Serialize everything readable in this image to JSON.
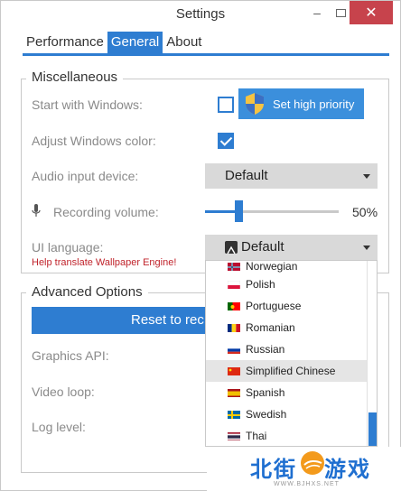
{
  "window": {
    "title": "Settings",
    "minimize_glyph": "–",
    "close_glyph": "✕"
  },
  "tabs": [
    {
      "label": "Performance",
      "active": false
    },
    {
      "label": "General",
      "active": true
    },
    {
      "label": "About",
      "active": false
    }
  ],
  "misc": {
    "title": "Miscellaneous",
    "start_with_windows": {
      "label": "Start with Windows:",
      "checked": false
    },
    "priority_button": "Set high priority",
    "adjust_color": {
      "label": "Adjust Windows color:",
      "checked": true
    },
    "audio_device": {
      "label": "Audio input device:",
      "value": "Default"
    },
    "recording_volume": {
      "label": "Recording volume:",
      "value": "50%",
      "level": 0.25
    },
    "ui_language": {
      "label": "UI language:",
      "value": "Default"
    },
    "help_link": "Help translate Wallpaper Engine!"
  },
  "advanced": {
    "title": "Advanced Options",
    "reset_button": "Reset to rec",
    "graphics_api": "Graphics API:",
    "video_loop": "Video loop:",
    "log_level": "Log level:"
  },
  "language_dropdown": {
    "items": [
      {
        "label": "Norwegian",
        "flag": "norway-flag"
      },
      {
        "label": "Polish",
        "flag": "poland-flag"
      },
      {
        "label": "Portuguese",
        "flag": "portugal-flag"
      },
      {
        "label": "Romanian",
        "flag": "romania-flag"
      },
      {
        "label": "Russian",
        "flag": "russia-flag"
      },
      {
        "label": "Simplified Chinese",
        "flag": "china-flag",
        "selected": true
      },
      {
        "label": "Spanish",
        "flag": "spain-flag"
      },
      {
        "label": "Swedish",
        "flag": "sweden-flag"
      },
      {
        "label": "Thai",
        "flag": "thailand-flag"
      }
    ]
  },
  "watermark": {
    "text_left": "北街",
    "text_right": "游戏",
    "url": "WWW.BJHXS.NET"
  },
  "colors": {
    "accent": "#2e7dd1",
    "close": "#c7434c",
    "link": "#c0232b"
  }
}
